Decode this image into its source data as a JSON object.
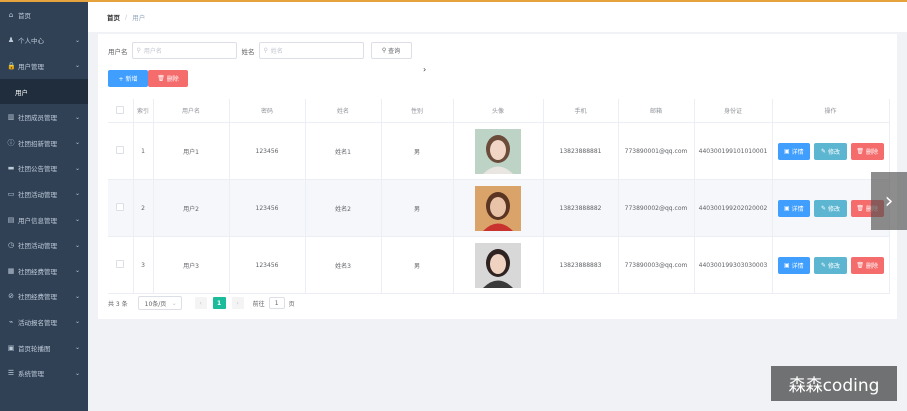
{
  "sidebar": {
    "items": [
      {
        "icon": "home-icon",
        "glyph": "⌂",
        "label": "首页",
        "chevron": false
      },
      {
        "icon": "user-icon",
        "glyph": "♟",
        "label": "个人中心",
        "chevron": true
      },
      {
        "icon": "lock-icon",
        "glyph": "🔒",
        "label": "用户管理",
        "chevron": true
      },
      {
        "icon": "none",
        "glyph": "",
        "label": "用户",
        "chevron": false,
        "sub": true
      },
      {
        "icon": "bar-chart-icon",
        "glyph": "▥",
        "label": "社团成员管理",
        "chevron": true
      },
      {
        "icon": "info-icon",
        "glyph": "ⓘ",
        "label": "社团招新管理",
        "chevron": true
      },
      {
        "icon": "list-icon",
        "glyph": "▬",
        "label": "社团公告管理",
        "chevron": true
      },
      {
        "icon": "chat-icon",
        "glyph": "▭",
        "label": "社团活动管理",
        "chevron": true
      },
      {
        "icon": "document-icon",
        "glyph": "▤",
        "label": "用户信息管理",
        "chevron": true
      },
      {
        "icon": "clock-icon",
        "glyph": "◷",
        "label": "社团活动管理",
        "chevron": true
      },
      {
        "icon": "calendar-icon",
        "glyph": "▦",
        "label": "社团经费管理",
        "chevron": true
      },
      {
        "icon": "compass-icon",
        "glyph": "⊘",
        "label": "社团经费管理",
        "chevron": true
      },
      {
        "icon": "chart-icon",
        "glyph": "⌁",
        "label": "活动报名管理",
        "chevron": true
      },
      {
        "icon": "image-icon",
        "glyph": "▣",
        "label": "首页轮播图",
        "chevron": true
      },
      {
        "icon": "settings-icon",
        "glyph": "☰",
        "label": "系统管理",
        "chevron": true
      }
    ]
  },
  "breadcrumb": {
    "home": "首页",
    "separator": "/",
    "current": "用户"
  },
  "search": {
    "username_label": "用户名",
    "username_placeholder": "用户名",
    "name_label": "姓名",
    "name_placeholder": "姓名",
    "search_button": "查询"
  },
  "actions": {
    "add_label": "+ 新增",
    "delete_label": "删除"
  },
  "table": {
    "headers": [
      "",
      "索引",
      "用户名",
      "密码",
      "姓名",
      "性别",
      "头像",
      "手机",
      "邮箱",
      "身份证",
      "操作"
    ],
    "rows": [
      {
        "index": "1",
        "username": "用户1",
        "password": "123456",
        "name": "姓名1",
        "gender": "男",
        "phone": "13823888881",
        "email": "773890001@qq.com",
        "idcard": "440300199101010001"
      },
      {
        "index": "2",
        "username": "用户2",
        "password": "123456",
        "name": "姓名2",
        "gender": "男",
        "phone": "13823888882",
        "email": "773890002@qq.com",
        "idcard": "440300199202020002"
      },
      {
        "index": "3",
        "username": "用户3",
        "password": "123456",
        "name": "姓名3",
        "gender": "男",
        "phone": "13823888883",
        "email": "773890003@qq.com",
        "idcard": "440300199303030003"
      }
    ],
    "op_detail": "详情",
    "op_edit": "修改",
    "op_delete": "删除"
  },
  "pager": {
    "total": "共 3 条",
    "page_size": "10条/页",
    "current_page": "1",
    "goto_label": "前往",
    "goto_value": "1",
    "page_suffix": "页"
  },
  "watermark": "森森coding",
  "colors": {
    "sidebar": "#304156",
    "primary": "#409eff",
    "danger": "#f56c6c",
    "info": "#5cb6d1",
    "pager_active": "#1abc9c"
  }
}
